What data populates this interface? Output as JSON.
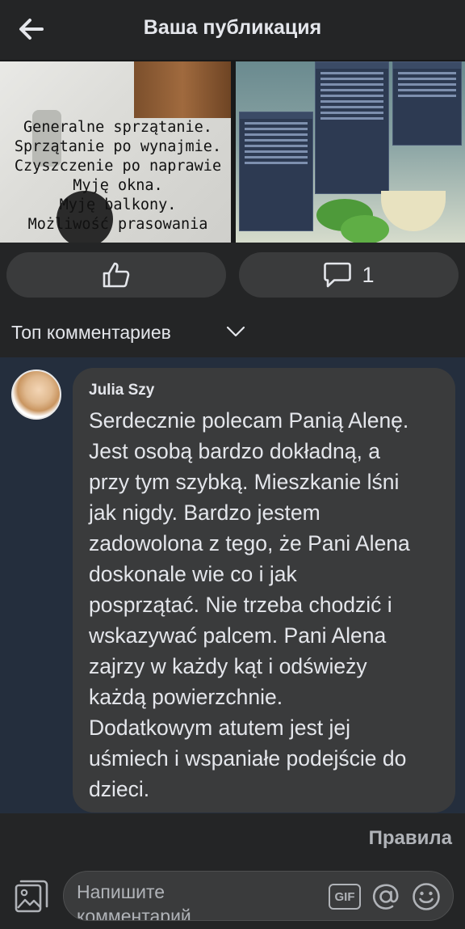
{
  "header": {
    "back_icon": "arrow-left-icon",
    "title": "Ваша публикация"
  },
  "post_images": {
    "image1_text": "Generalne sprzątanie.\nSprzątanie po wynajmie.\nCzyszczenie po naprawie\nMyję okna.\nMyję balkony.\nMożliwość prasowania"
  },
  "actions": {
    "like_icon": "thumbs-up-icon",
    "comment_icon": "speech-bubble-icon",
    "comment_count": "1"
  },
  "sort": {
    "label": "Топ комментариев",
    "chevron_icon": "chevron-down-icon"
  },
  "comments": [
    {
      "author": "Julia Szy",
      "text": "Serdecznie polecam Panią Alenę.\nJest osobą bardzo dokładną, a\nprzy tym szybką. Mieszkanie lśni\njak nigdy. Bardzo jestem\nzadowolona z tego, że Pani Alena\ndoskonale wie co i jak\nposprzątać. Nie trzeba chodzić i\nwskazywać palcem. Pani Alena\nzajrzy w każdy kąt i odświeży\nkażdą powierzchnie.\nDodatkowym atutem jest jej\nuśmiech i wspaniałe podejście do\ndzieci."
    }
  ],
  "footer": {
    "rules_label": "Правила",
    "photo_icon": "photo-icon",
    "input_placeholder": "Напишите комментарий",
    "gif_label": "GIF",
    "at_icon": "at-sign-icon",
    "emoji_icon": "smiley-icon"
  },
  "colors": {
    "background": "#18191a",
    "surface": "#242526",
    "pill": "#3a3b3c",
    "comments_bg": "#242e3d",
    "text": "#e4e6eb",
    "muted": "#b0b3b8"
  }
}
